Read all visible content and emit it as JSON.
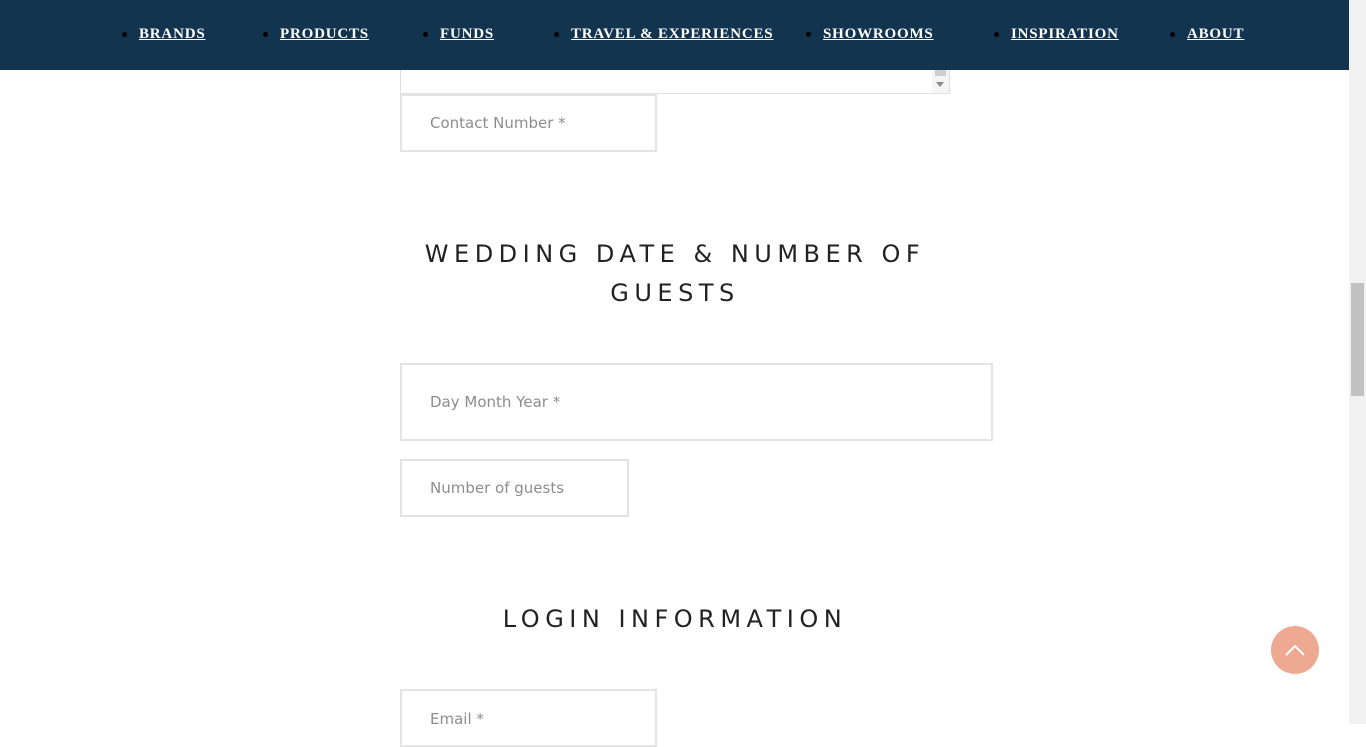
{
  "nav": {
    "items": [
      {
        "label": "BRANDS"
      },
      {
        "label": "PRODUCTS"
      },
      {
        "label": "FUNDS"
      },
      {
        "label": "TRAVEL & EXPERIENCES"
      },
      {
        "label": "SHOWROOMS"
      },
      {
        "label": "INSPIRATION"
      },
      {
        "label": "ABOUT"
      }
    ],
    "background": "#12344f"
  },
  "contact": {
    "phone_placeholder": "Contact Number *"
  },
  "wedding": {
    "title": "WEDDING DATE & NUMBER OF GUESTS",
    "date_placeholder": "Day Month Year *",
    "guests_placeholder": "Number of guests"
  },
  "login": {
    "title": "LOGIN INFORMATION",
    "email_placeholder": "Email *"
  },
  "colors": {
    "accent": "#eda991",
    "field_border": "#e4e4e4",
    "placeholder_text": "#8d8d8d"
  },
  "icons": {
    "back_to_top": "chevron-up-icon"
  }
}
